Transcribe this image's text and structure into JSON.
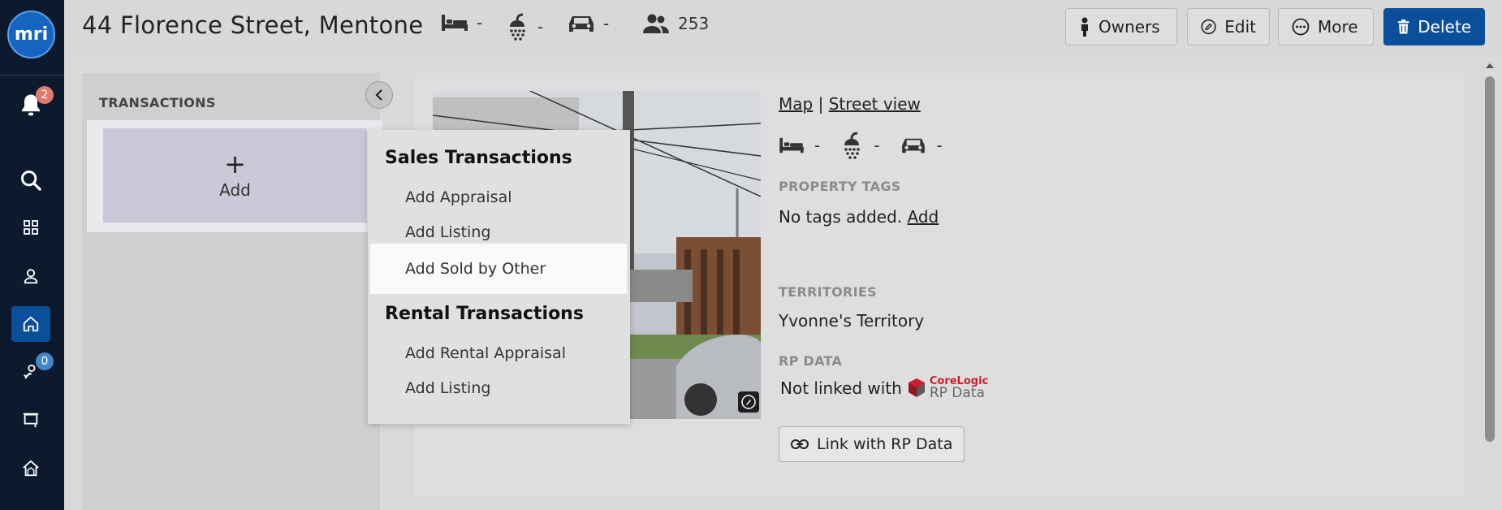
{
  "sidebar": {
    "logo_text": "mri",
    "notifications_count": "2",
    "tasks_count": "0"
  },
  "header": {
    "title": "44 Florence Street, Mentone",
    "beds": "-",
    "baths": "-",
    "cars": "-",
    "contacts_count": "253",
    "buttons": {
      "owners": "Owners",
      "edit": "Edit",
      "more": "More",
      "delete": "Delete"
    }
  },
  "transactions": {
    "heading": "TRANSACTIONS",
    "add_label": "Add",
    "add_symbol": "+"
  },
  "dropdown": {
    "sales_heading": "Sales Transactions",
    "sales_items": [
      "Add Appraisal",
      "Add Listing",
      "Add Sold by Other"
    ],
    "rental_heading": "Rental Transactions",
    "rental_items": [
      "Add Rental Appraisal",
      "Add Listing"
    ]
  },
  "property": {
    "map_link": "Map",
    "separator": "|",
    "street_view_link": "Street view",
    "beds": "-",
    "baths": "-",
    "cars": "-",
    "tags_label": "PROPERTY TAGS",
    "tags_text": "No tags added.",
    "tags_add": "Add",
    "territories_label": "TERRITORIES",
    "territory": "Yvonne's Territory",
    "rpdata_label": "RP DATA",
    "rpdata_status": "Not linked with",
    "corelogic_brand": "CoreLogic",
    "rpdata_brand": "RP Data",
    "link_button": "Link with RP Data"
  },
  "colors": {
    "sidebar_bg": "#0d1a2e",
    "primary": "#0b4f9b",
    "badge_red": "#e07b6c",
    "badge_blue": "#3f87c9",
    "corelogic_red": "#c8202f"
  }
}
